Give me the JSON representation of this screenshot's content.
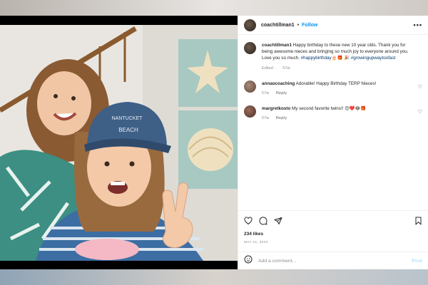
{
  "post": {
    "author": "coachtillman1",
    "follow_label": "Follow",
    "more_label": "•••",
    "caption": {
      "username": "coachtillman1",
      "text": "Happy birthday to these new 10 year olds. Thank you for being awesome nieces and bringing so much joy to everyone around you. Love you so much.",
      "hashtag1": "#happybirthday",
      "emoji1": "🎂🎁",
      "emoji2": "🎉",
      "hashtag2": "#growingupwaytoofast",
      "edited": "Edited",
      "time": "57w"
    },
    "comments": [
      {
        "username": "annaocoaching",
        "text": "Adorable! Happy Birthday TERP Nieces!",
        "time": "57w",
        "reply": "Reply"
      },
      {
        "username": "margretkosto",
        "text": "My second favorite twins!! 😊❤️😂🎁",
        "time": "57w",
        "reply": "Reply"
      }
    ],
    "likes": "234 likes",
    "date": "MAY 21, 2023",
    "add_comment_placeholder": "Add a comment...",
    "post_button": "Post",
    "photo": {
      "hat_text_line1": "NANTUCKET",
      "hat_text_line2": "BEACH"
    }
  },
  "colors": {
    "link": "#0095f6",
    "hashtag": "#00376b",
    "muted": "#8e8e8e"
  },
  "icons": [
    "heart-icon",
    "comment-icon",
    "share-icon",
    "bookmark-icon",
    "emoji-icon"
  ]
}
